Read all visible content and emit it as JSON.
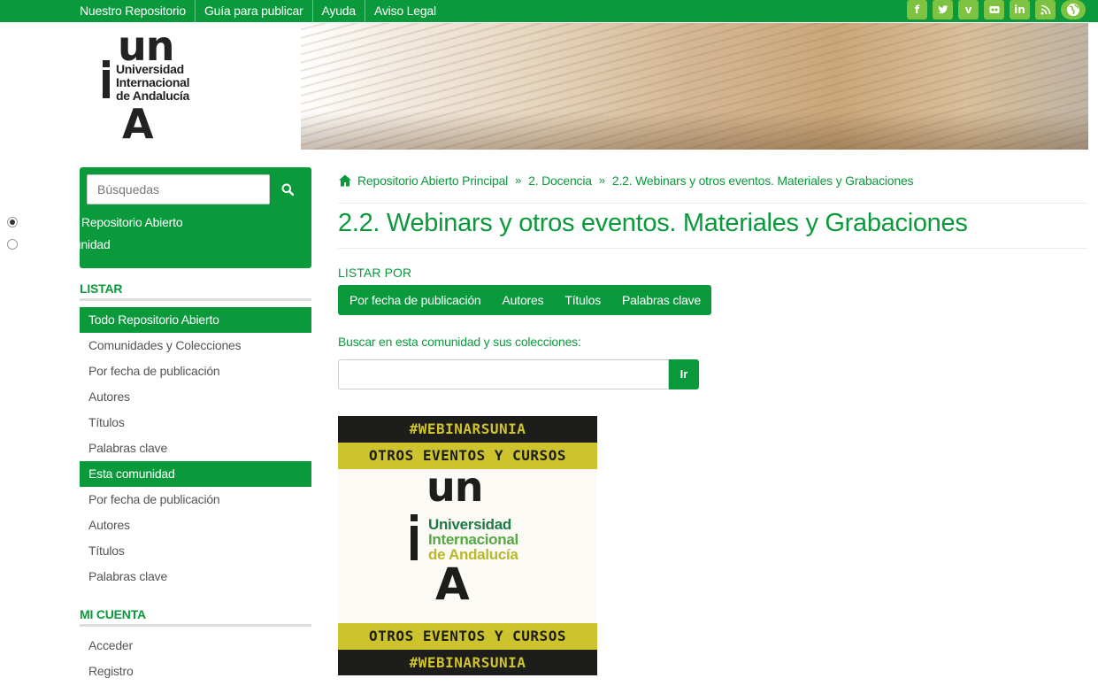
{
  "topnav": {
    "items": [
      "Nuestro Repositorio",
      "Guía para publicar",
      "Ayuda",
      "Aviso Legal"
    ],
    "social_icons": [
      "facebook-icon",
      "twitter-icon",
      "vimeo-icon",
      "flickr-icon",
      "linkedin-icon",
      "rss-icon",
      "globe-icon"
    ]
  },
  "banner": {
    "logo": {
      "un": "un",
      "line1": "Universidad",
      "line2": "Internacional",
      "line3": "de Andalucía",
      "letter": "A"
    }
  },
  "sidebar": {
    "search_placeholder": "Búsquedas",
    "scope_options": [
      "Buscar en Repositorio Abierto",
      "Esta comunidad"
    ],
    "scope_selected": 0,
    "listar_heading": "LISTAR",
    "listar_items": [
      {
        "label": "Todo Repositorio Abierto",
        "active": true
      },
      {
        "label": "Comunidades y Colecciones",
        "active": false
      },
      {
        "label": "Por fecha de publicación",
        "active": false
      },
      {
        "label": "Autores",
        "active": false
      },
      {
        "label": "Títulos",
        "active": false
      },
      {
        "label": "Palabras clave",
        "active": false
      },
      {
        "label": "Esta comunidad",
        "active": true
      },
      {
        "label": "Por fecha de publicación",
        "active": false
      },
      {
        "label": "Autores",
        "active": false
      },
      {
        "label": "Títulos",
        "active": false
      },
      {
        "label": "Palabras clave",
        "active": false
      }
    ],
    "account_heading": "MI CUENTA",
    "account_items": [
      "Acceder",
      "Registro"
    ]
  },
  "main": {
    "breadcrumb": [
      "Repositorio Abierto Principal",
      "2. Docencia",
      "2.2. Webinars y otros eventos. Materiales y Grabaciones"
    ],
    "breadcrumb_separator": "»",
    "title": "2.2. Webinars y otros eventos. Materiales y Grabaciones",
    "listar_por": "LISTAR POR",
    "browse_buttons": [
      "Por fecha de publicación",
      "Autores",
      "Títulos",
      "Palabras clave"
    ],
    "scope_search_label": "Buscar en esta comunidad y sus colecciones:",
    "scope_search_value": "",
    "scope_search_button": "Ir",
    "poster": {
      "band1": "#WEBINARSUNIA",
      "band2": "OTROS EVENTOS Y CURSOS",
      "logo_un": "un",
      "logo_line1": "Universidad",
      "logo_line2": "Internacional",
      "logo_line3": "de Andalucía",
      "logo_letter": "A",
      "band3": "OTROS EVENTOS Y CURSOS",
      "band4": "#WEBINARSUNIA"
    }
  },
  "colors": {
    "brand_green": "#0a9a3c",
    "social_green": "#7ec242",
    "poster_yellow": "#cdc32d",
    "poster_black": "#1d1d1b"
  }
}
